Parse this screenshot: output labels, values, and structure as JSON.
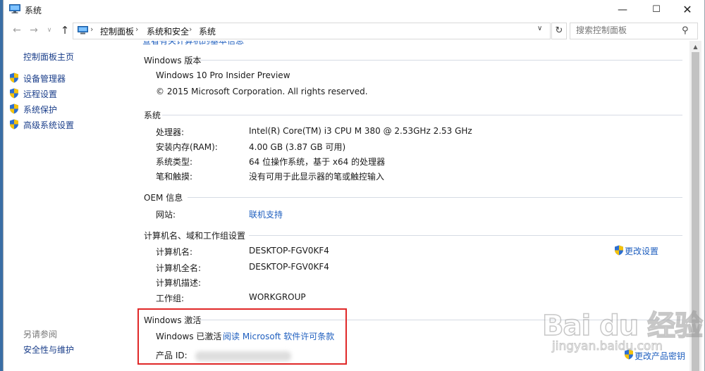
{
  "window": {
    "title": "系统",
    "controls": {
      "minimize": "—",
      "maximize": "☐",
      "close": "✕"
    }
  },
  "nav": {
    "back": "←",
    "forward": "→",
    "history": "∨",
    "up": "↑",
    "breadcrumb": [
      "控制面板",
      "系统和安全",
      "系统"
    ],
    "separator": "›",
    "dropdown": "∨",
    "refresh": "↻",
    "search_placeholder": "搜索控制面板",
    "search_glyph": "⚲"
  },
  "left_pane": {
    "home": "控制面板主页",
    "items": [
      "设备管理器",
      "远程设置",
      "系统保护",
      "高级系统设置"
    ],
    "see_also": "另请参阅",
    "security": "安全性与维护"
  },
  "content": {
    "clipped_text": "查看有关计算机的基本信息",
    "windows_edition": {
      "title": "Windows 版本",
      "name": "Windows 10 Pro Insider Preview",
      "copyright": "© 2015 Microsoft Corporation. All rights reserved."
    },
    "system": {
      "title": "系统",
      "rows": [
        {
          "label": "处理器:",
          "value": "Intel(R) Core(TM) i3 CPU       M 380  @ 2.53GHz   2.53 GHz"
        },
        {
          "label": "安装内存(RAM):",
          "value": "4.00 GB (3.87 GB 可用)"
        },
        {
          "label": "系统类型:",
          "value": "64 位操作系统，基于 x64 的处理器"
        },
        {
          "label": "笔和触摸:",
          "value": "没有可用于此显示器的笔或触控输入"
        }
      ]
    },
    "oem": {
      "title": "OEM 信息",
      "website_label": "网站:",
      "website_link": "联机支持"
    },
    "computer": {
      "title": "计算机名、域和工作组设置",
      "rows": [
        {
          "label": "计算机名:",
          "value": "DESKTOP-FGV0KF4"
        },
        {
          "label": "计算机全名:",
          "value": "DESKTOP-FGV0KF4"
        },
        {
          "label": "计算机描述:",
          "value": ""
        },
        {
          "label": "工作组:",
          "value": "WORKGROUP"
        }
      ],
      "change_settings": "更改设置"
    },
    "activation": {
      "title": "Windows 激活",
      "status": "Windows 已激活",
      "license_link": "阅读 Microsoft 软件许可条款",
      "product_id_label": "产品 ID:",
      "change_key": "更改产品密钥"
    }
  },
  "watermark": {
    "main": "Bai du 经验",
    "sub": "jingyan.baidu.com"
  },
  "colors": {
    "link": "#1f5fbf",
    "highlight": "#e02828",
    "section_line": "#d6dbe4"
  }
}
